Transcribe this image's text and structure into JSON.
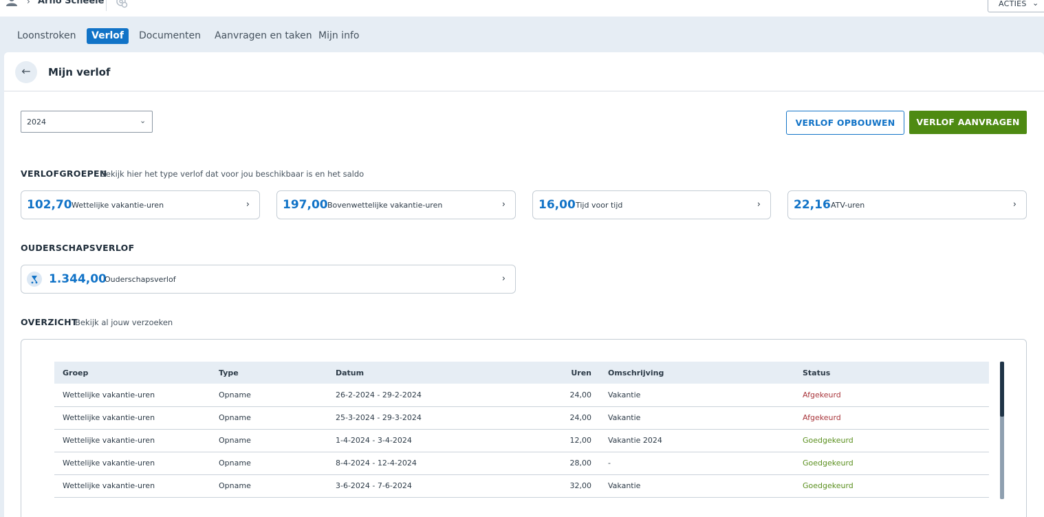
{
  "topbar": {
    "user_name": "Arno Scheele",
    "user_icon": "person-icon",
    "settings_icon": "settings-icon",
    "actions_label": "ACTIES"
  },
  "tabs": [
    {
      "label": "Loonstroken",
      "active": false
    },
    {
      "label": "Verlof",
      "active": true
    },
    {
      "label": "Documenten",
      "active": false
    },
    {
      "label": "Aanvragen en taken",
      "active": false
    },
    {
      "label": "Mijn info",
      "active": false
    }
  ],
  "page": {
    "title": "Mijn verlof",
    "back_icon": "arrow-left-icon"
  },
  "year_select": {
    "value": "2024"
  },
  "buttons": {
    "build_leave": "VERLOF OPBOUWEN",
    "request_leave": "VERLOF AANVRAGEN"
  },
  "leave_groups": {
    "title": "VERLOFGROEPEN",
    "subtitle": "Bekijk hier het type verlof dat voor jou beschikbaar is en het saldo",
    "cards": [
      {
        "value": "102,70",
        "label": "Wettelijke vakantie-uren"
      },
      {
        "value": "197,00",
        "label": "Bovenwettelijke vakantie-uren"
      },
      {
        "value": "16,00",
        "label": "Tijd voor tijd"
      },
      {
        "value": "22,16",
        "label": "ATV-uren"
      }
    ]
  },
  "parental_leave": {
    "title": "OUDERSCHAPSVERLOF",
    "card": {
      "value": "1.344,00",
      "label": "Ouderschapsverlof",
      "icon": "stroller-icon"
    }
  },
  "overview": {
    "title": "OVERZICHT",
    "subtitle": "Bekijk al jouw verzoeken",
    "columns": [
      "Groep",
      "Type",
      "Datum",
      "Uren",
      "Omschrijving",
      "Status"
    ],
    "rows": [
      {
        "groep": "Wettelijke vakantie-uren",
        "type": "Opname",
        "datum": "26-2-2024 - 29-2-2024",
        "uren": "24,00",
        "omschrijving": "Vakantie",
        "status": "Afgekeurd"
      },
      {
        "groep": "Wettelijke vakantie-uren",
        "type": "Opname",
        "datum": "25-3-2024 - 29-3-2024",
        "uren": "24,00",
        "omschrijving": "Vakantie",
        "status": "Afgekeurd"
      },
      {
        "groep": "Wettelijke vakantie-uren",
        "type": "Opname",
        "datum": "1-4-2024 - 3-4-2024",
        "uren": "12,00",
        "omschrijving": "Vakantie 2024",
        "status": "Goedgekeurd"
      },
      {
        "groep": "Wettelijke vakantie-uren",
        "type": "Opname",
        "datum": "8-4-2024 - 12-4-2024",
        "uren": "28,00",
        "omschrijving": "-",
        "status": "Goedgekeurd"
      },
      {
        "groep": "Wettelijke vakantie-uren",
        "type": "Opname",
        "datum": "3-6-2024 - 7-6-2024",
        "uren": "32,00",
        "omschrijving": "Vakantie",
        "status": "Goedgekeurd"
      }
    ]
  },
  "colors": {
    "primary_blue": "#1173c7",
    "primary_green": "#4e8a12",
    "status_rejected": "#a8343a",
    "status_approved": "#5a8f1e",
    "nav_background": "#e6edf4"
  }
}
